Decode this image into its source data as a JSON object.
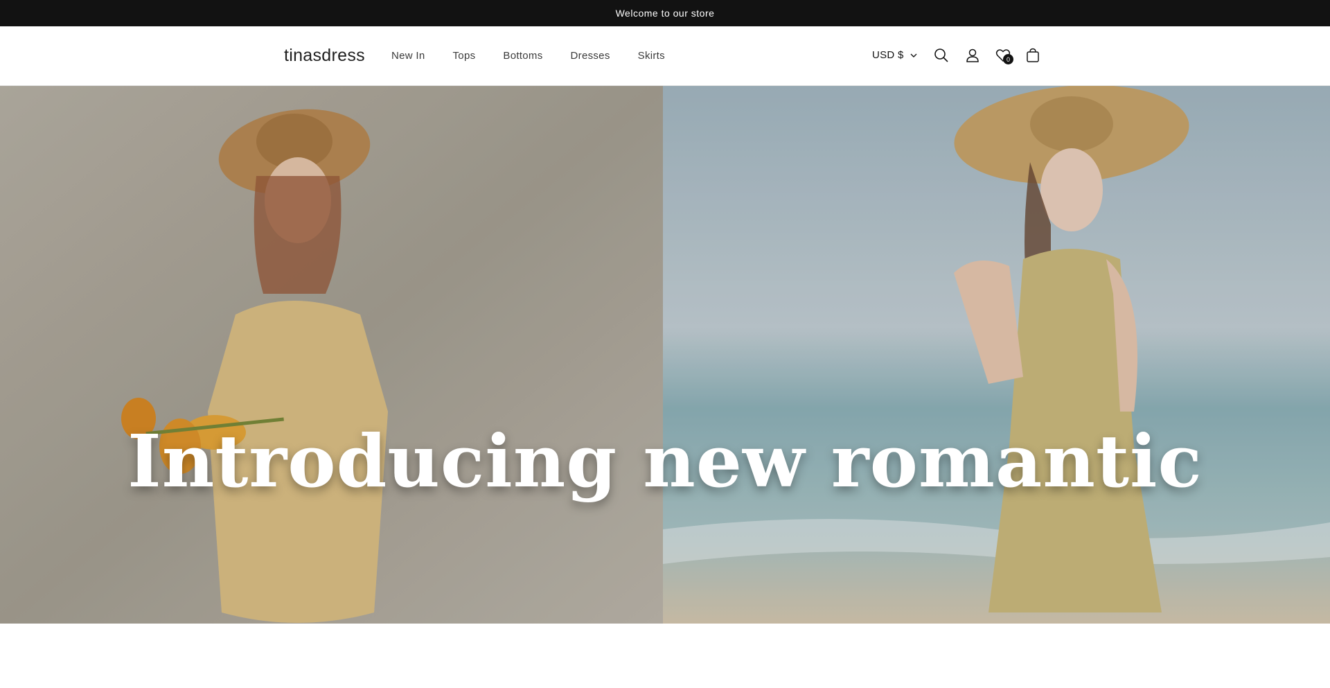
{
  "announcement": {
    "text": "Welcome to our store"
  },
  "header": {
    "logo": "tinasdress",
    "nav": [
      {
        "label": "New In"
      },
      {
        "label": "Tops"
      },
      {
        "label": "Bottoms"
      },
      {
        "label": "Dresses"
      },
      {
        "label": "Skirts"
      }
    ],
    "currency": "USD $",
    "icons": {
      "search": "search-icon",
      "account": "account-icon",
      "wishlist": "heart-icon",
      "cart": "cart-icon"
    },
    "wishlist_count": "0"
  },
  "hero": {
    "heading": "Introducing new romantic",
    "colors": {
      "left_bg": "#a9a295",
      "right_bg": "#a9bcc6",
      "sea": "#8eb2b9",
      "sand": "#d9cab2"
    }
  },
  "colors": {
    "announcement_bg": "#121212",
    "text": "#121212"
  }
}
